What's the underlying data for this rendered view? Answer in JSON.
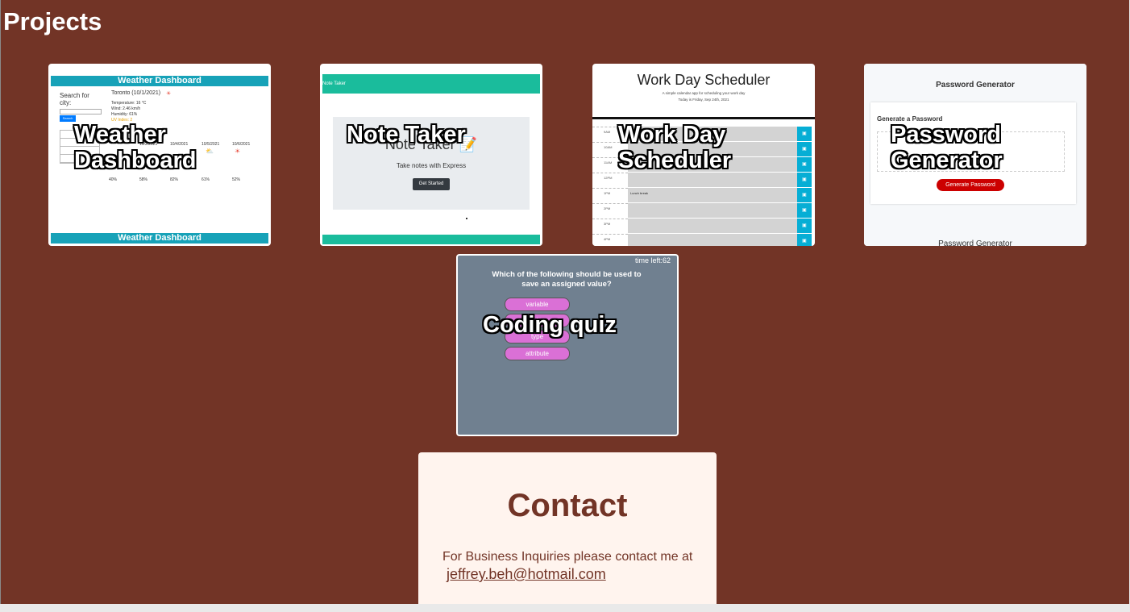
{
  "projects": {
    "heading": "Projects",
    "cards": [
      {
        "title": "Weather Dashboard",
        "title_line1": "Weather",
        "title_line2": "Dashboard",
        "preview": {
          "header": "Weather Dashboard",
          "search_label": "Search for city:",
          "search_placeholder": "Search",
          "search_button": "Search",
          "city": "Toronto    (10/1/2021)",
          "temperature": "Temperature: 16 °C",
          "wind": "Wind: 2.46 km/h",
          "humidity": "Humidity: 61%",
          "uv": "UV Index: 2",
          "forecast_dates": [
            "10/2/2021",
            "10/3/2021",
            "10/4/2021",
            "10/5/2021",
            "10/6/2021"
          ],
          "forecast_humidity": [
            "40%",
            "58%",
            "82%",
            "61%",
            "52%"
          ],
          "footer": "Weather Dashboard"
        }
      },
      {
        "title": "Note Taker",
        "preview": {
          "nav": "Note Taker",
          "heading": "Note Taker 📝",
          "subtitle": "Take notes with Express",
          "button": "Get Started"
        }
      },
      {
        "title": "Work Day Scheduler",
        "title_line1": "Work Day",
        "title_line2": "Scheduler",
        "preview": {
          "heading": "Work Day Scheduler",
          "subtitle": "A simple calendar app for scheduling your work day",
          "date": "Today is Friday, Sep 24th, 2021",
          "hours": [
            "9AM",
            "10AM",
            "11AM",
            "12PM",
            "1PM",
            "2PM",
            "3PM",
            "4PM"
          ],
          "entries": [
            "",
            "",
            "",
            "",
            "Lunch break",
            "",
            "",
            ""
          ],
          "save_icon": "save-icon"
        }
      },
      {
        "title": "Password Generator",
        "title_line1": "Password",
        "title_line2": "Generator",
        "preview": {
          "heading": "Password Generator",
          "label": "Generate a Password",
          "button": "Generate Password",
          "footer": "Password Generator"
        }
      },
      {
        "title": "Coding quiz",
        "preview": {
          "timer": "time left:62",
          "question": "Which of the following should be used to save an assigned value?",
          "answers": [
            "variable",
            "string",
            "type",
            "attribute"
          ]
        }
      }
    ]
  },
  "contact": {
    "heading": "Contact",
    "text": "For Business Inquiries please contact me at",
    "email": "jeffrey.beh@hotmail.com"
  },
  "colors": {
    "page_background": "#723426",
    "contact_background": "#fff4ee",
    "quiz_background": "#708090",
    "quiz_answer": "#da70d6"
  }
}
